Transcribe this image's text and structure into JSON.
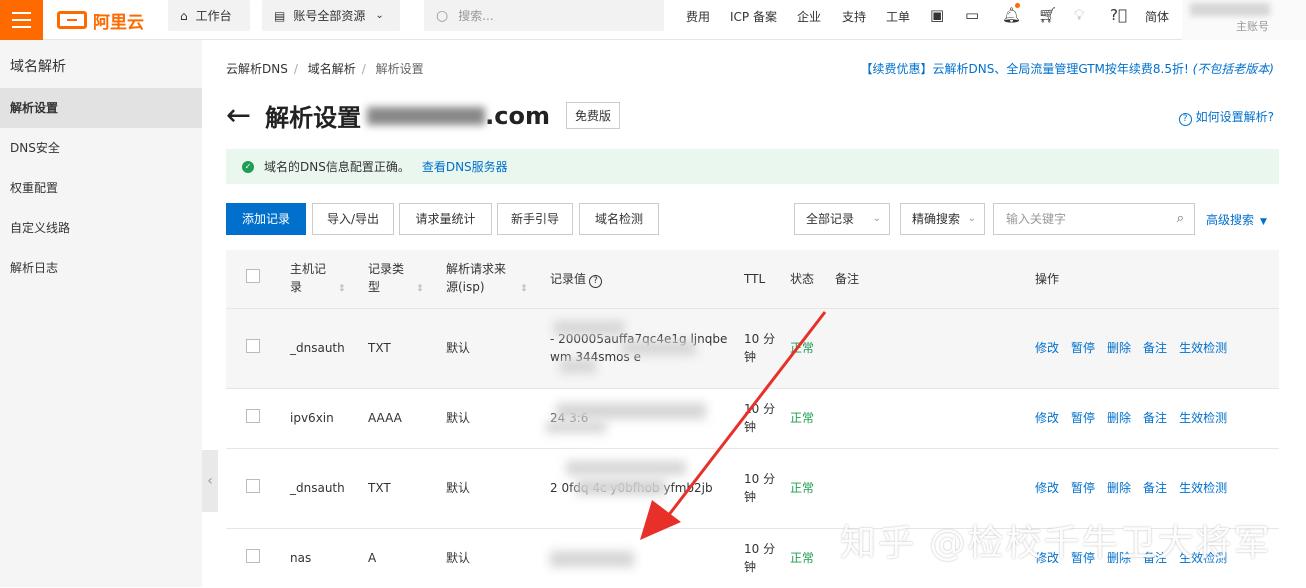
{
  "topbar": {
    "logo": "阿里云",
    "workbench": "工作台",
    "resource": "账号全部资源",
    "search_placeholder": "搜索...",
    "links": [
      "费用",
      "ICP 备案",
      "企业",
      "支持",
      "工单"
    ],
    "lang": "简体",
    "account": "主账号"
  },
  "sidebar": {
    "title": "域名解析",
    "items": [
      "解析设置",
      "DNS安全",
      "权重配置",
      "自定义线路",
      "解析日志"
    ]
  },
  "breadcrumb": [
    "云解析DNS",
    "域名解析",
    "解析设置"
  ],
  "promo": {
    "text": "【续费优惠】云解析DNS、全局流量管理GTM按年续费8.5折!",
    "note": "(不包括老版本)"
  },
  "page": {
    "title": "解析设置",
    "domain_tld": ".com",
    "edition": "免费版",
    "howto": "如何设置解析?"
  },
  "alert": {
    "text": "域名的DNS信息配置正确。",
    "link": "查看DNS服务器"
  },
  "toolbar": {
    "add": "添加记录",
    "import": "导入/导出",
    "stats": "请求量统计",
    "guide": "新手引导",
    "check": "域名检测",
    "all_records": "全部记录",
    "precise": "精确搜索",
    "kw_placeholder": "输入关键字",
    "advanced": "高级搜索"
  },
  "columns": {
    "host": "主机记录",
    "type": "记录类型",
    "line": "解析请求来源(isp)",
    "value": "记录值",
    "ttl": "TTL",
    "status": "状态",
    "remark": "备注",
    "ops": "操作"
  },
  "rows": [
    {
      "host": "_dnsauth",
      "type": "TXT",
      "line": "默认",
      "value": "-                  200005auffa7qc4e1g ljnqbewm            344smos e",
      "ttl": "10 分钟",
      "status": "正常"
    },
    {
      "host": "ipv6xin",
      "type": "AAAA",
      "line": "默认",
      "value": "24                              3:6",
      "ttl": "10 分钟",
      "status": "正常"
    },
    {
      "host": "_dnsauth",
      "type": "TXT",
      "line": "默认",
      "value": "2                             0fdq 4c                        y0bfhob yfmb2jb",
      "ttl": "10 分钟",
      "status": "正常"
    },
    {
      "host": "nas",
      "type": "A",
      "line": "默认",
      "value": "",
      "ttl": "10 分钟",
      "status": "正常"
    }
  ],
  "ops": [
    "修改",
    "暂停",
    "删除",
    "备注",
    "生效检测"
  ],
  "watermark": "知乎 @检校千牛卫大将军",
  "colors": {
    "brand": "#ff6a00",
    "primary": "#0070cc",
    "ok": "#1e9e52",
    "arrow": "#e8302a"
  }
}
